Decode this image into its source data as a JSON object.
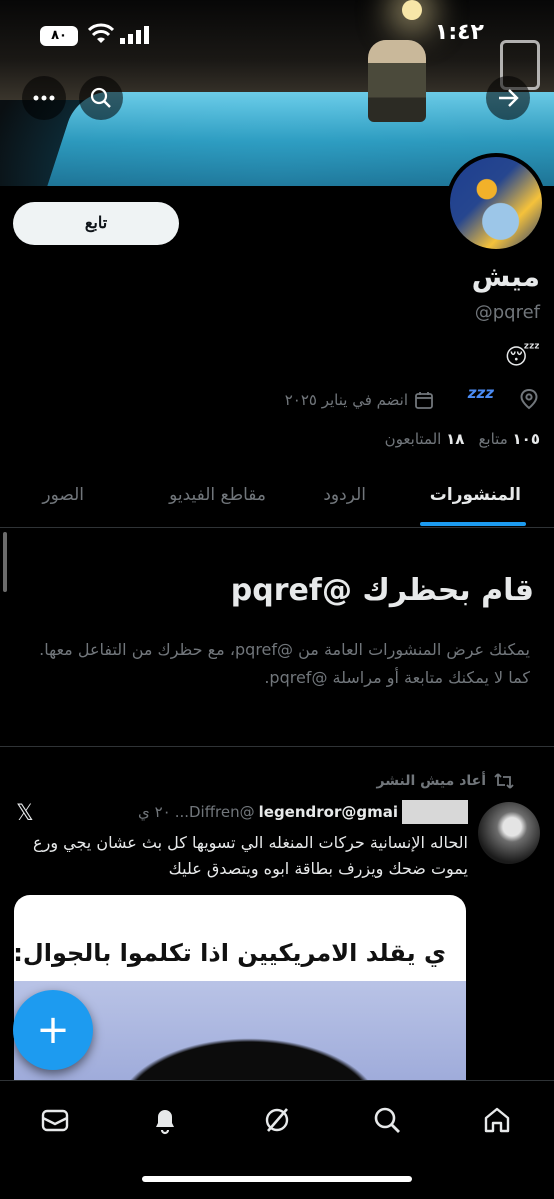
{
  "status_bar": {
    "time": "١:٤٢",
    "battery": "٨٠"
  },
  "profile": {
    "display_name": "ميش",
    "handle": "@pqref",
    "bio_emoji": "😴",
    "joined": "انضم في يناير ٢٠٢٥",
    "zzz": "zzz",
    "following_count": "١٠٥",
    "following_label": "متابع",
    "followers_count": "١٨",
    "followers_label": "المتابعون",
    "follow_label": "تابع"
  },
  "tabs": [
    {
      "label": "المنشورات",
      "active": true
    },
    {
      "label": "الردود",
      "active": false
    },
    {
      "label": "مقاطع الفيديو",
      "active": false
    },
    {
      "label": "الصور",
      "active": false
    }
  ],
  "blocked": {
    "title": "قام بحظرك @pqref",
    "description": "يمكنك عرض المنشورات العامة من @pqref، مع حظرك من التفاعل معها. كما لا يمكنك متابعة أو مراسلة @pqref."
  },
  "post": {
    "repost_label": "أعاد ميش النشر",
    "author_name": "legendror@gmai",
    "author_handle": "@Diffren...",
    "time": "٢٠ ي",
    "x_logo": "𝕏",
    "text": "الحاله الإنسانية حركات المنغله الي تسويها كل بث عشان يجي ورع يموت ضحك ويزرف بطاقة ابوه ويتصدق عليك",
    "media_caption": "ي يقلد الامريكيين اذا تكلموا بالجوال:"
  },
  "fab_label": "+",
  "colors": {
    "accent": "#1d9bf0",
    "background": "#000000",
    "muted": "#71767b"
  },
  "icons": [
    "back-arrow-icon",
    "search-icon",
    "more-icon",
    "calendar-icon",
    "location-icon",
    "repost-icon",
    "mail-icon",
    "bell-icon",
    "grok-icon",
    "search-nav-icon",
    "home-icon"
  ]
}
